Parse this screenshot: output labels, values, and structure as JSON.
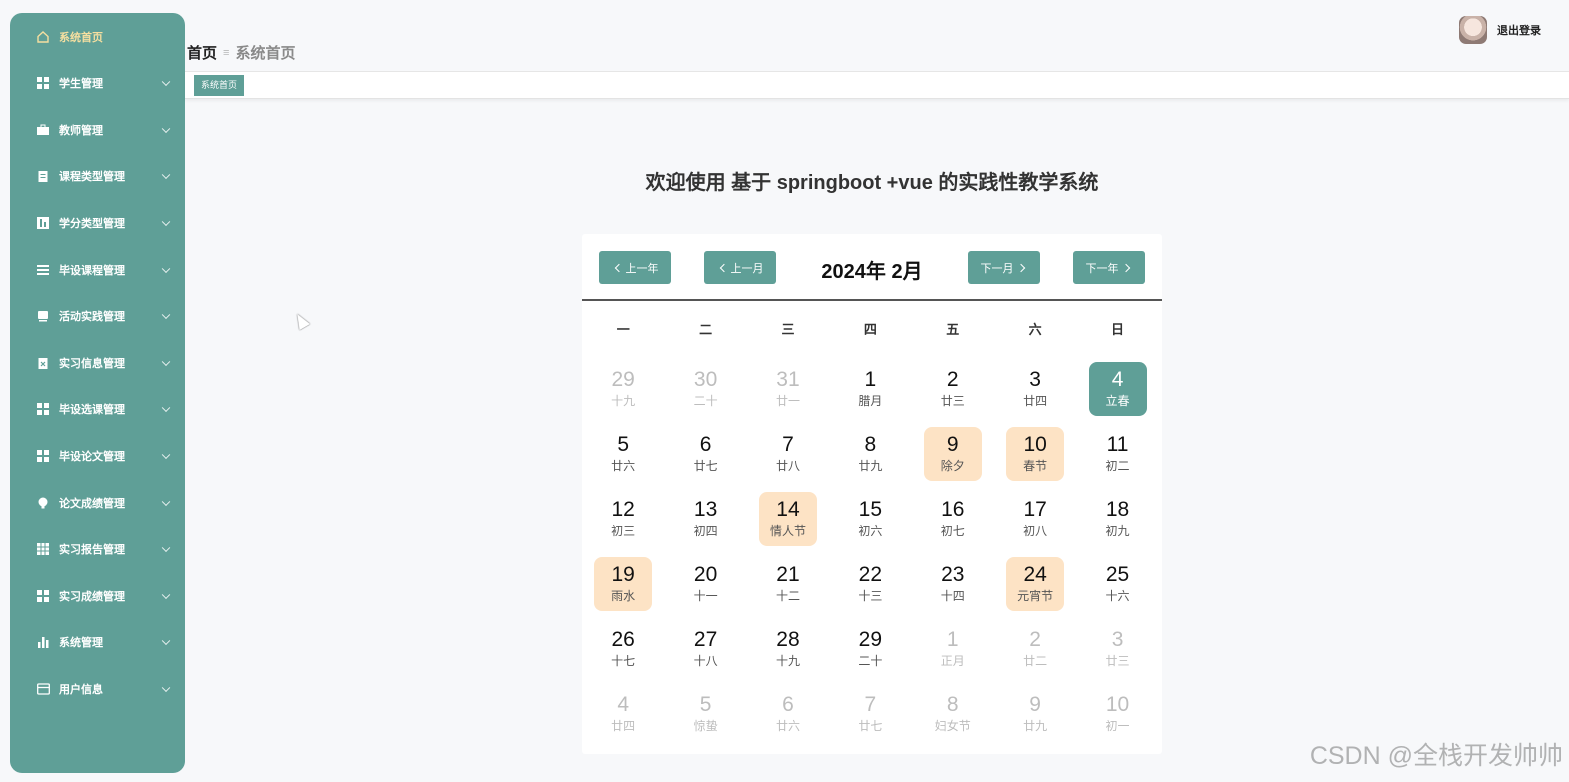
{
  "sidebar": {
    "items": [
      {
        "label": "系统首页",
        "icon": "home-icon"
      },
      {
        "label": "学生管理",
        "icon": "grid-icon"
      },
      {
        "label": "教师管理",
        "icon": "briefcase-icon"
      },
      {
        "label": "课程类型管理",
        "icon": "clipboard-icon"
      },
      {
        "label": "学分类型管理",
        "icon": "chart-icon"
      },
      {
        "label": "毕设课程管理",
        "icon": "list-icon"
      },
      {
        "label": "活动实践管理",
        "icon": "box-icon"
      },
      {
        "label": "实习信息管理",
        "icon": "clipboard-x-icon"
      },
      {
        "label": "毕设选课管理",
        "icon": "grid-icon"
      },
      {
        "label": "毕设论文管理",
        "icon": "grid-icon"
      },
      {
        "label": "论文成绩管理",
        "icon": "bulb-icon"
      },
      {
        "label": "实习报告管理",
        "icon": "table-icon"
      },
      {
        "label": "实习成绩管理",
        "icon": "grid-icon"
      },
      {
        "label": "系统管理",
        "icon": "bar-chart-icon"
      },
      {
        "label": "用户信息",
        "icon": "card-icon"
      }
    ]
  },
  "header": {
    "breadcrumb_root": "首页",
    "breadcrumb_sep": "≡",
    "breadcrumb_current": "系统首页",
    "logout_label": "退出登录"
  },
  "tabs": {
    "active": "系统首页"
  },
  "welcome": "欢迎使用 基于 springboot +vue 的实践性教学系统",
  "calendar": {
    "title": "2024年 2月",
    "prev_year": "上一年",
    "prev_month": "上一月",
    "next_month": "下一月",
    "next_year": "下一年",
    "weekdays": [
      "一",
      "二",
      "三",
      "四",
      "五",
      "六",
      "日"
    ],
    "days": [
      {
        "n": "29",
        "l": "十九",
        "other": true
      },
      {
        "n": "30",
        "l": "二十",
        "other": true
      },
      {
        "n": "31",
        "l": "廿一",
        "other": true
      },
      {
        "n": "1",
        "l": "腊月"
      },
      {
        "n": "2",
        "l": "廿三"
      },
      {
        "n": "3",
        "l": "廿四"
      },
      {
        "n": "4",
        "l": "立春",
        "today": true
      },
      {
        "n": "5",
        "l": "廿六"
      },
      {
        "n": "6",
        "l": "廿七"
      },
      {
        "n": "7",
        "l": "廿八"
      },
      {
        "n": "8",
        "l": "廿九"
      },
      {
        "n": "9",
        "l": "除夕",
        "holiday": true
      },
      {
        "n": "10",
        "l": "春节",
        "holiday": true
      },
      {
        "n": "11",
        "l": "初二"
      },
      {
        "n": "12",
        "l": "初三"
      },
      {
        "n": "13",
        "l": "初四"
      },
      {
        "n": "14",
        "l": "情人节",
        "holiday": true
      },
      {
        "n": "15",
        "l": "初六"
      },
      {
        "n": "16",
        "l": "初七"
      },
      {
        "n": "17",
        "l": "初八"
      },
      {
        "n": "18",
        "l": "初九"
      },
      {
        "n": "19",
        "l": "雨水",
        "holiday": true
      },
      {
        "n": "20",
        "l": "十一"
      },
      {
        "n": "21",
        "l": "十二"
      },
      {
        "n": "22",
        "l": "十三"
      },
      {
        "n": "23",
        "l": "十四"
      },
      {
        "n": "24",
        "l": "元宵节",
        "holiday": true
      },
      {
        "n": "25",
        "l": "十六"
      },
      {
        "n": "26",
        "l": "十七"
      },
      {
        "n": "27",
        "l": "十八"
      },
      {
        "n": "28",
        "l": "十九"
      },
      {
        "n": "29",
        "l": "二十"
      },
      {
        "n": "1",
        "l": "正月",
        "other": true
      },
      {
        "n": "2",
        "l": "廿二",
        "other": true
      },
      {
        "n": "3",
        "l": "廿三",
        "other": true
      },
      {
        "n": "4",
        "l": "廿四",
        "other": true
      },
      {
        "n": "5",
        "l": "惊蛰",
        "other": true
      },
      {
        "n": "6",
        "l": "廿六",
        "other": true
      },
      {
        "n": "7",
        "l": "廿七",
        "other": true
      },
      {
        "n": "8",
        "l": "妇女节",
        "other": true
      },
      {
        "n": "9",
        "l": "廿九",
        "other": true
      },
      {
        "n": "10",
        "l": "初一",
        "other": true
      }
    ]
  },
  "watermark": "CSDN @全栈开发帅帅",
  "colors": {
    "accent": "#5f9f97",
    "holiday": "#fde3c5",
    "home_label": "#f5dfa0"
  }
}
